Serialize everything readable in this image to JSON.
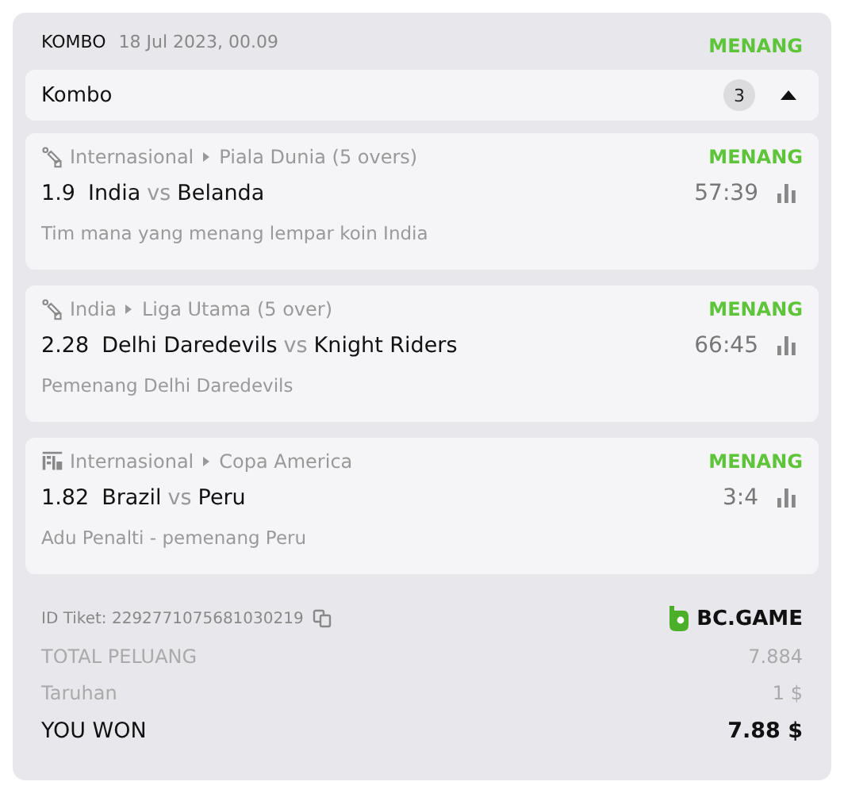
{
  "header": {
    "type": "KOMBO",
    "date": "18 Jul 2023, 00.09",
    "status": "MENANG"
  },
  "combo": {
    "title": "Kombo",
    "count": "3",
    "expanded": true
  },
  "legs": [
    {
      "kind": "cricket",
      "category": "Internasional",
      "league": "Piala Dunia (5 overs)",
      "status": "MENANG",
      "odds": "1.9",
      "home": "India",
      "vs": "vs",
      "away": "Belanda",
      "score": "57:39",
      "market": "Tim mana yang menang lempar koin India"
    },
    {
      "kind": "cricket",
      "category": "India",
      "league": "Liga Utama (5 over)",
      "status": "MENANG",
      "odds": "2.28",
      "home": "Delhi Daredevils",
      "vs": "vs",
      "away": "Knight Riders",
      "score": "66:45",
      "market": "Pemenang Delhi Daredevils"
    },
    {
      "kind": "penalty",
      "category": "Internasional",
      "league": "Copa America",
      "status": "MENANG",
      "odds": "1.82",
      "home": "Brazil",
      "vs": "vs",
      "away": "Peru",
      "score": "3:4",
      "market": "Adu Penalti - pemenang Peru"
    }
  ],
  "ticket_id": "ID Tiket: 2292771075681030219",
  "brand": "BC.GAME",
  "summary": [
    {
      "label": "TOTAL PELUANG",
      "value": "7.884",
      "kind": "muted"
    },
    {
      "label": "Taruhan",
      "value": "1 $",
      "kind": "muted"
    },
    {
      "label": "YOU WON",
      "value": "7.88 $",
      "kind": "total"
    }
  ]
}
